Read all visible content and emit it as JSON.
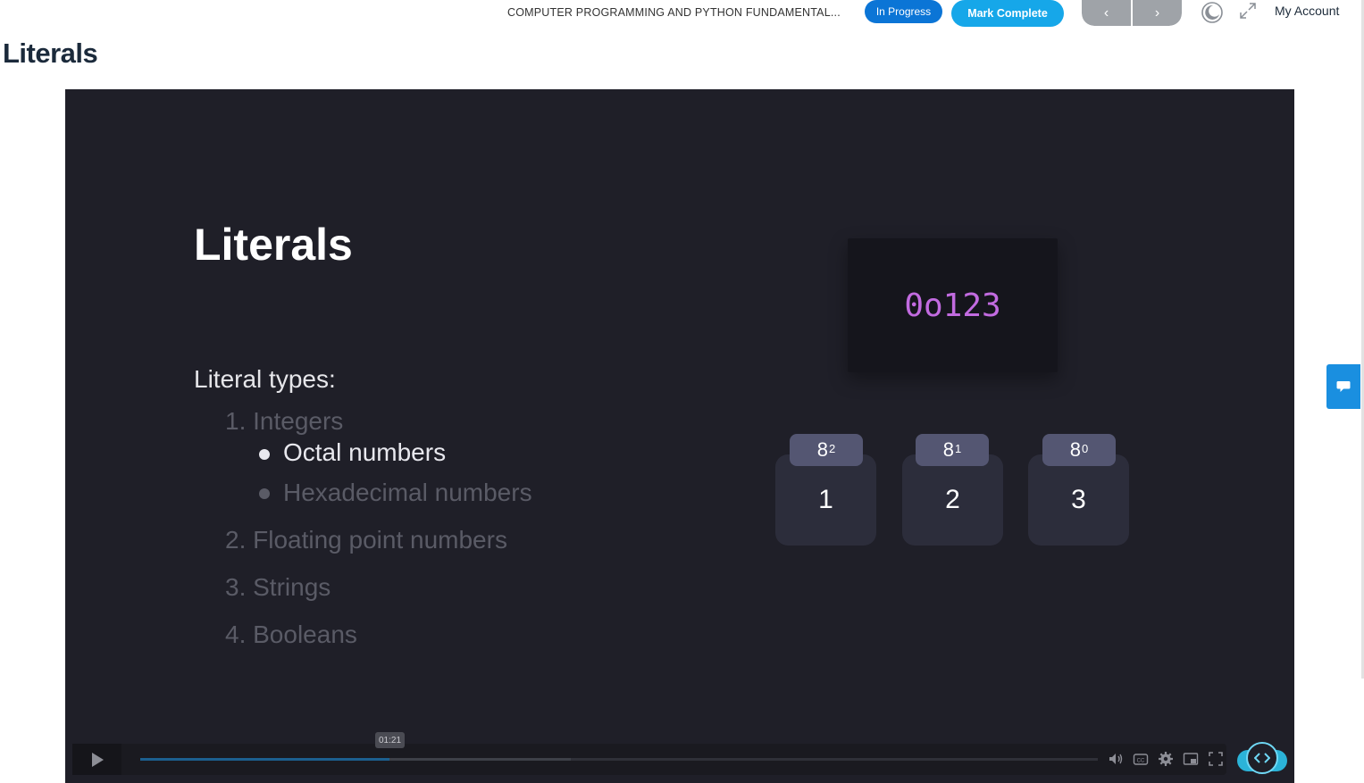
{
  "header": {
    "course_title": "COMPUTER PROGRAMMING AND PYTHON FUNDAMENTAL...",
    "status_label": "In Progress",
    "mark_complete_label": "Mark Complete",
    "prev_label": "‹",
    "next_label": "›",
    "account_label": "My Account"
  },
  "page": {
    "title": "Literals"
  },
  "slide": {
    "title": "Literals",
    "types_heading": "Literal types:",
    "items": [
      {
        "label": "1. Integers",
        "active": false
      },
      {
        "label": "Octal numbers",
        "active": true,
        "sub": true
      },
      {
        "label": "Hexadecimal numbers",
        "active": false,
        "sub": true
      },
      {
        "label": "2. Floating point numbers",
        "active": false
      },
      {
        "label": "3. Strings",
        "active": false
      },
      {
        "label": "4. Booleans",
        "active": false
      }
    ],
    "code": "0o123",
    "digits": [
      {
        "base": "8",
        "exp": "2",
        "value": "1"
      },
      {
        "base": "8",
        "exp": "1",
        "value": "2"
      },
      {
        "base": "8",
        "exp": "0",
        "value": "3"
      }
    ]
  },
  "player": {
    "time_tooltip": "01:21",
    "progress": 0.26,
    "buffered": 0.45,
    "icons": [
      "play-icon",
      "volume-icon",
      "captions-icon",
      "settings-icon",
      "pip-icon",
      "fullscreen-icon"
    ]
  },
  "colors": {
    "accent": "#16a7e9",
    "status": "#0b75d6",
    "code": "#c26be0",
    "slide_bg": "#1f1f28"
  }
}
